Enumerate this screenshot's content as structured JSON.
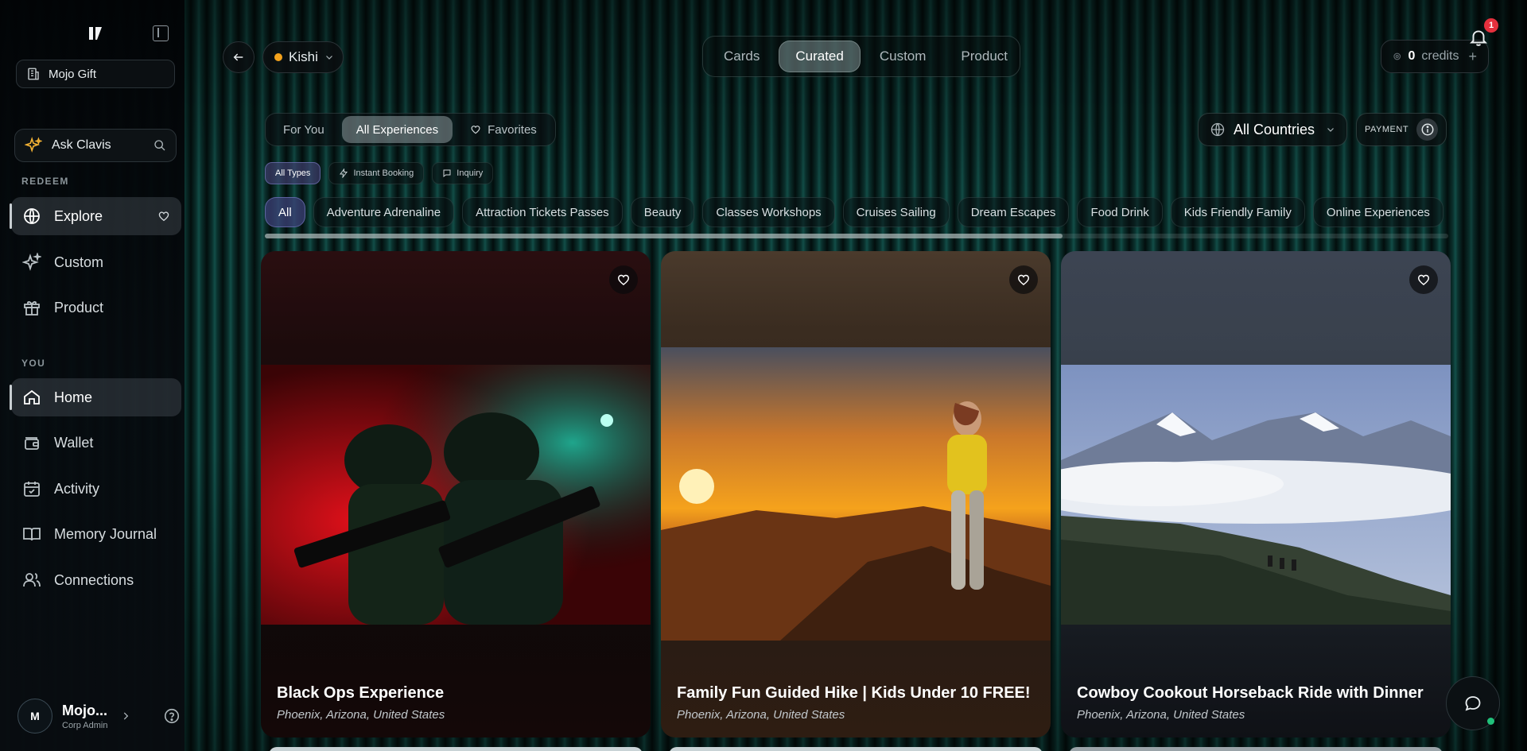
{
  "sidebar": {
    "org_name": "Mojo Gift",
    "ask_label": "Ask Clavis",
    "section_redeem": "REDEEM",
    "section_you": "YOU",
    "redeem_items": [
      {
        "label": "Explore",
        "icon": "globe-icon"
      },
      {
        "label": "Custom",
        "icon": "sparkles-icon"
      },
      {
        "label": "Product",
        "icon": "gift-icon"
      }
    ],
    "you_items": [
      {
        "label": "Home",
        "icon": "home-icon"
      },
      {
        "label": "Wallet",
        "icon": "wallet-icon"
      },
      {
        "label": "Activity",
        "icon": "calendar-check-icon"
      },
      {
        "label": "Memory Journal",
        "icon": "book-open-icon"
      },
      {
        "label": "Connections",
        "icon": "users-icon"
      }
    ],
    "user": {
      "initial": "M",
      "name": "Mojo...",
      "role": "Corp Admin"
    }
  },
  "topbar": {
    "selected_user": "Kishi",
    "mode_tabs": [
      "Cards",
      "Curated",
      "Custom",
      "Product"
    ],
    "active_mode": "Curated",
    "credits_value": "0",
    "credits_label": "credits",
    "notification_count": "1"
  },
  "filters": {
    "view_tabs": [
      "For You",
      "All Experiences",
      "Favorites"
    ],
    "active_view": "All Experiences",
    "country": "All Countries",
    "payment_label": "PAYMENT",
    "types": [
      "All Types",
      "Instant Booking",
      "Inquiry"
    ],
    "categories": [
      "All",
      "Adventure Adrenaline",
      "Attraction Tickets Passes",
      "Beauty",
      "Classes Workshops",
      "Cruises Sailing",
      "Dream Escapes",
      "Food Drink",
      "Kids Friendly Family",
      "Online Experiences"
    ]
  },
  "cards": [
    {
      "title": "Black Ops Experience",
      "location": "Phoenix, Arizona, United States"
    },
    {
      "title": "Family Fun Guided Hike | Kids Under 10 FREE!",
      "location": "Phoenix, Arizona, United States"
    },
    {
      "title": "Cowboy Cookout Horseback Ride with Dinner",
      "location": "Phoenix, Arizona, United States"
    }
  ],
  "colors": {
    "accent_orange": "#f4a21c",
    "badge_red": "#e5303d",
    "online_green": "#20c07a"
  }
}
